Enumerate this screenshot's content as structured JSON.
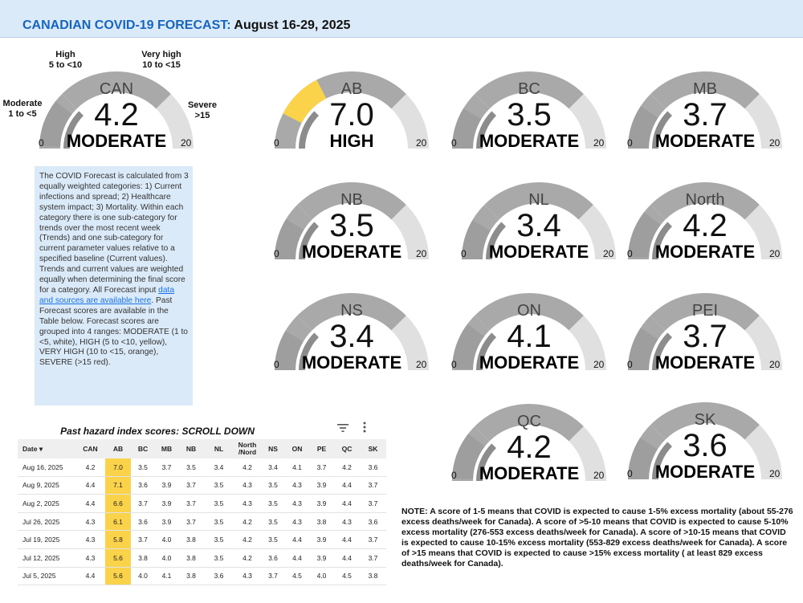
{
  "header": {
    "title_blue": "CANADIAN COVID-19 FORECAST:",
    "title_dates": " August 16-29, 2025"
  },
  "colors": {
    "header_bg": "#dbeaf8",
    "title_blue": "#1565c0",
    "moderate_band": "#9e9e9e",
    "high_band": "#fbd34a",
    "track_light": "#e0e0e0",
    "track_dark": "#a9a9a9"
  },
  "gauge_axis": {
    "min": "0",
    "max": "20"
  },
  "range_labels": {
    "moderate": [
      "Moderate",
      "1 to <5"
    ],
    "high": [
      "High",
      "5 to <10"
    ],
    "very_high": [
      "Very high",
      "10 to <15"
    ],
    "severe": [
      "Severe",
      ">15"
    ]
  },
  "gauges": [
    {
      "region": "CAN",
      "score": "4.2",
      "value": 4.2,
      "category": "MODERATE"
    },
    {
      "region": "AB",
      "score": "7.0",
      "value": 7.0,
      "category": "HIGH"
    },
    {
      "region": "BC",
      "score": "3.5",
      "value": 3.5,
      "category": "MODERATE"
    },
    {
      "region": "MB",
      "score": "3.7",
      "value": 3.7,
      "category": "MODERATE"
    },
    {
      "region": "NB",
      "score": "3.5",
      "value": 3.5,
      "category": "MODERATE"
    },
    {
      "region": "NL",
      "score": "3.4",
      "value": 3.4,
      "category": "MODERATE"
    },
    {
      "region": "North",
      "score": "4.2",
      "value": 4.2,
      "category": "MODERATE"
    },
    {
      "region": "NS",
      "score": "3.4",
      "value": 3.4,
      "category": "MODERATE"
    },
    {
      "region": "ON",
      "score": "4.1",
      "value": 4.1,
      "category": "MODERATE"
    },
    {
      "region": "PEI",
      "score": "3.7",
      "value": 3.7,
      "category": "MODERATE"
    },
    {
      "region": "QC",
      "score": "4.2",
      "value": 4.2,
      "category": "MODERATE"
    },
    {
      "region": "SK",
      "score": "3.6",
      "value": 3.6,
      "category": "MODERATE"
    }
  ],
  "info": {
    "text_before_link": "The COVID Forecast is calculated from 3 equally weighted categories: 1) Current infections and spread; 2) Healthcare system impact; 3) Mortality. Within each category there is one sub-category for trends over the most recent week (Trends) and one sub-category for current parameter values relative to a specified baseline (Current values). Trends and current values are weighted equally when determining the final score for a category. All Forecast input ",
    "link_text": "data and sources are available here",
    "text_after_link": ". Past Forecast scores are available in the Table below. Forecast scores are grouped into 4 ranges: MODERATE (1 to <5, white), HIGH (5 to <10, yellow), VERY HIGH (10 to <15, orange), SEVERE (>15 red)."
  },
  "history": {
    "title": "Past hazard index scores: SCROLL DOWN",
    "date_header": "Date",
    "sort_indicator": "▾",
    "columns": [
      "CAN",
      "AB",
      "BC",
      "MB",
      "NB",
      "NL",
      "North /Nord",
      "NS",
      "ON",
      "PE",
      "QC",
      "SK"
    ],
    "rows": [
      [
        "Aug 16, 2025",
        "4.2",
        "7.0",
        "3.5",
        "3.7",
        "3.5",
        "3.4",
        "4.2",
        "3.4",
        "4.1",
        "3.7",
        "4.2",
        "3.6"
      ],
      [
        "Aug 9, 2025",
        "4.4",
        "7.1",
        "3.6",
        "3.9",
        "3.7",
        "3.5",
        "4.3",
        "3.5",
        "4.3",
        "3.9",
        "4.4",
        "3.7"
      ],
      [
        "Aug 2, 2025",
        "4.4",
        "6.6",
        "3.7",
        "3.9",
        "3.7",
        "3.5",
        "4.3",
        "3.5",
        "4.3",
        "3.9",
        "4.4",
        "3.7"
      ],
      [
        "Jul 26, 2025",
        "4.3",
        "6.1",
        "3.6",
        "3.9",
        "3.7",
        "3.5",
        "4.2",
        "3.5",
        "4.3",
        "3.8",
        "4.3",
        "3.6"
      ],
      [
        "Jul 19, 2025",
        "4.3",
        "5.8",
        "3.7",
        "4.0",
        "3.8",
        "3.5",
        "4.2",
        "3.5",
        "4.4",
        "3.9",
        "4.4",
        "3.7"
      ],
      [
        "Jul 12, 2025",
        "4.3",
        "5.6",
        "3.8",
        "4.0",
        "3.8",
        "3.5",
        "4.2",
        "3.6",
        "4.4",
        "3.9",
        "4.4",
        "3.7"
      ],
      [
        "Jul 5, 2025",
        "4.4",
        "5.6",
        "4.0",
        "4.1",
        "3.8",
        "3.6",
        "4.3",
        "3.7",
        "4.5",
        "4.0",
        "4.5",
        "3.8"
      ]
    ]
  },
  "note": "NOTE: A score of 1-5 means that COVID is expected to cause 1-5% excess mortality (about 55-276 excess deaths/week for Canada). A score of >5-10 means that COVID is expected to cause 5-10% excess mortality (276-553 excess deaths/week for Canada). A score of >10-15 means that COVID is expected to cause 10-15% excess mortality (553-829 excess deaths/week for Canada). A score of >15 means that COVID is expected to cause >15% excess mortality ( at least 829 excess deaths/week for Canada)."
}
